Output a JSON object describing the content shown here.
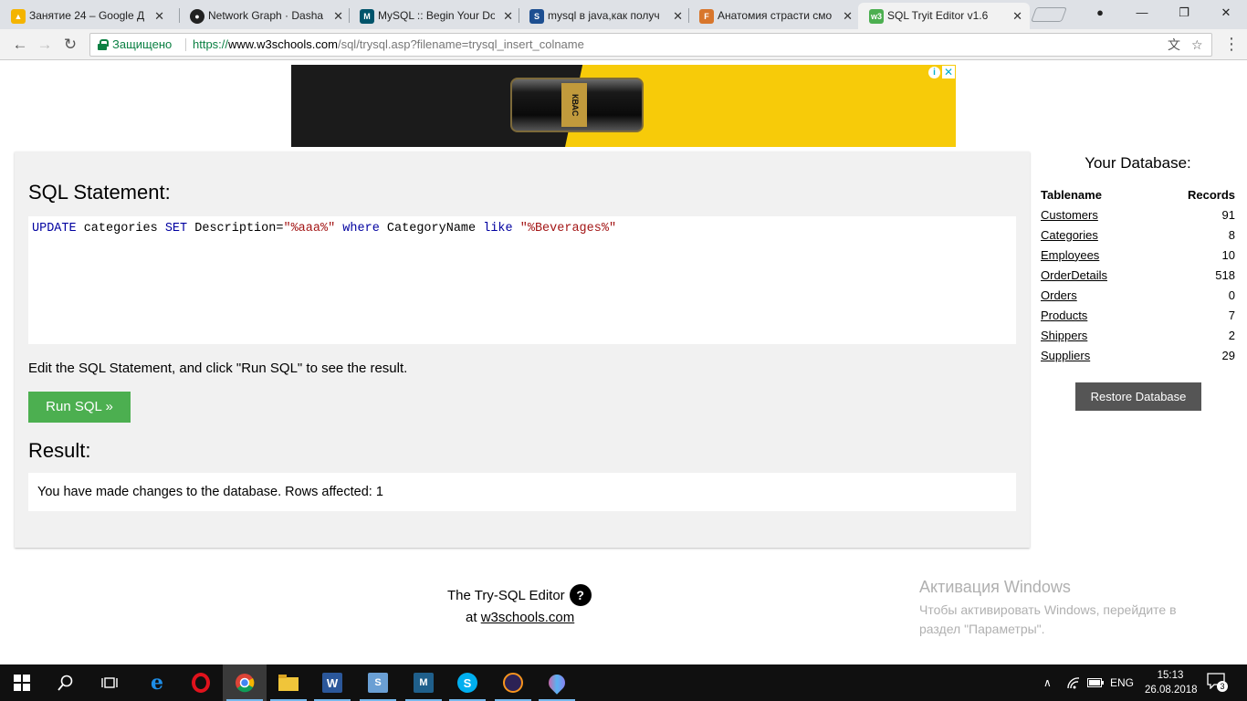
{
  "browser": {
    "tabs": [
      {
        "title": "Занятие 24 – Google Д",
        "favicon_color": "#f4b400"
      },
      {
        "title": "Network Graph · Dasha",
        "favicon_color": "#222222"
      },
      {
        "title": "MySQL :: Begin Your Do",
        "favicon_color": "#00546b"
      },
      {
        "title": "mysql в java,как получ",
        "favicon_color": "#1d4f91"
      },
      {
        "title": "Анатомия страсти смо",
        "favicon_color": "#d8762c"
      },
      {
        "title": "SQL Tryit Editor v1.6",
        "favicon_color": "#4caf50"
      }
    ],
    "secure_label": "Защищено",
    "url_scheme": "https://",
    "url_host": "www.w3schools.com",
    "url_path": "/sql/trysql.asp?filename=trysql_insert_colname"
  },
  "ad": {
    "can_text": "КВАС"
  },
  "editor": {
    "heading": "SQL Statement:",
    "tokens": [
      {
        "t": "UPDATE",
        "c": "kw"
      },
      {
        "t": " categories ",
        "c": "plain"
      },
      {
        "t": "SET",
        "c": "kw"
      },
      {
        "t": " Description=",
        "c": "plain"
      },
      {
        "t": "\"%aaa%\"",
        "c": "str"
      },
      {
        "t": " ",
        "c": "plain"
      },
      {
        "t": "where",
        "c": "kw"
      },
      {
        "t": " CategoryName ",
        "c": "plain"
      },
      {
        "t": "like",
        "c": "kw"
      },
      {
        "t": " ",
        "c": "plain"
      },
      {
        "t": "\"%Beverages%\"",
        "c": "str"
      }
    ],
    "hint": "Edit the SQL Statement, and click \"Run SQL\" to see the result.",
    "run_label": "Run SQL »",
    "result_heading": "Result:",
    "result_text": "You have made changes to the database. Rows affected: 1"
  },
  "database": {
    "title": "Your Database:",
    "col_name": "Tablename",
    "col_records": "Records",
    "tables": [
      {
        "name": "Customers",
        "records": "91"
      },
      {
        "name": "Categories",
        "records": "8"
      },
      {
        "name": "Employees",
        "records": "10"
      },
      {
        "name": "OrderDetails",
        "records": "518"
      },
      {
        "name": "Orders",
        "records": "0"
      },
      {
        "name": "Products",
        "records": "7"
      },
      {
        "name": "Shippers",
        "records": "2"
      },
      {
        "name": "Suppliers",
        "records": "29"
      }
    ],
    "restore_label": "Restore Database"
  },
  "footer": {
    "line1": "The Try-SQL Editor",
    "at": "at ",
    "link": "w3schools.com"
  },
  "watermark": {
    "title": "Активация Windows",
    "text": "Чтобы активировать Windows, перейдите в раздел \"Параметры\"."
  },
  "taskbar": {
    "lang": "ENG",
    "time": "15:13",
    "date": "26.08.2018",
    "notifications": "3",
    "apps": [
      "start-icon",
      "search-icon",
      "task-view-icon",
      "edge-icon",
      "opera-icon",
      "chrome-icon",
      "explorer-icon",
      "word-icon",
      "sql-developer-icon",
      "mysql-workbench-icon",
      "skype-icon",
      "eclipse-icon",
      "paint-3d-icon"
    ]
  },
  "colors": {
    "run_button": "#4caf50",
    "restore_button": "#555555",
    "panel_bg": "#f1f1f1",
    "sql_keyword": "#0000a0",
    "sql_string": "#a31515"
  }
}
